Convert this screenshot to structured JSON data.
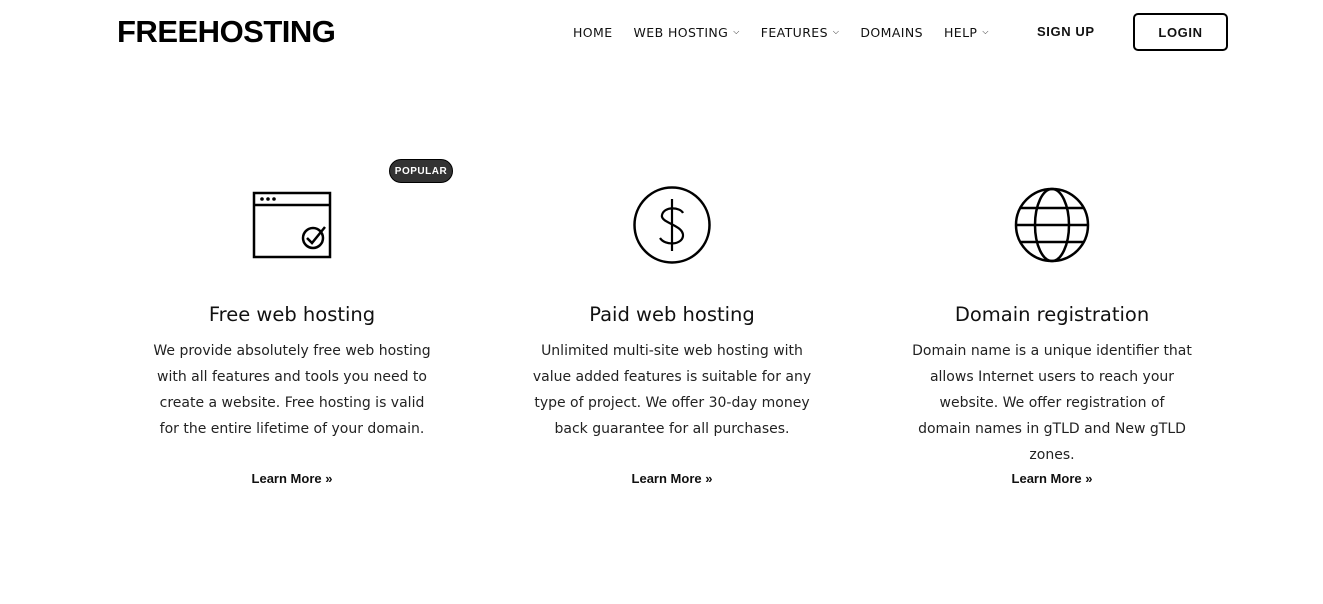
{
  "header": {
    "logo": "FREEHOSTING",
    "nav": [
      {
        "label": "HOME",
        "has_dropdown": false,
        "icon": ""
      },
      {
        "label": "WEB HOSTING",
        "has_dropdown": true,
        "icon": "chevron-down-icon"
      },
      {
        "label": "FEATURES",
        "has_dropdown": true,
        "icon": "chevron-down-icon"
      },
      {
        "label": "DOMAINS",
        "has_dropdown": false,
        "icon": ""
      },
      {
        "label": "HELP",
        "has_dropdown": true,
        "icon": "chevron-down-icon"
      }
    ],
    "signup_label": "SIGN UP",
    "login_label": "LOGIN"
  },
  "badge": "POPULAR",
  "cards": [
    {
      "icon": "browser-check-icon",
      "title": "Free web hosting",
      "text": "We provide absolutely free web hosting with all features and tools you need to create a website. Free hosting is valid for the entire lifetime of your domain.",
      "link": "Learn More »"
    },
    {
      "icon": "dollar-circle-icon",
      "title": "Paid web hosting",
      "text": "Unlimited multi-site web hosting with value added features is suitable for any type of project. We offer 30-day money back guarantee for all purchases.",
      "link": "Learn More »"
    },
    {
      "icon": "globe-icon",
      "title": "Domain registration",
      "text": "Domain name is a unique identifier that allows Internet users to reach your website. We offer registration of domain names in gTLD and New gTLD zones.",
      "link": "Learn More »"
    }
  ]
}
